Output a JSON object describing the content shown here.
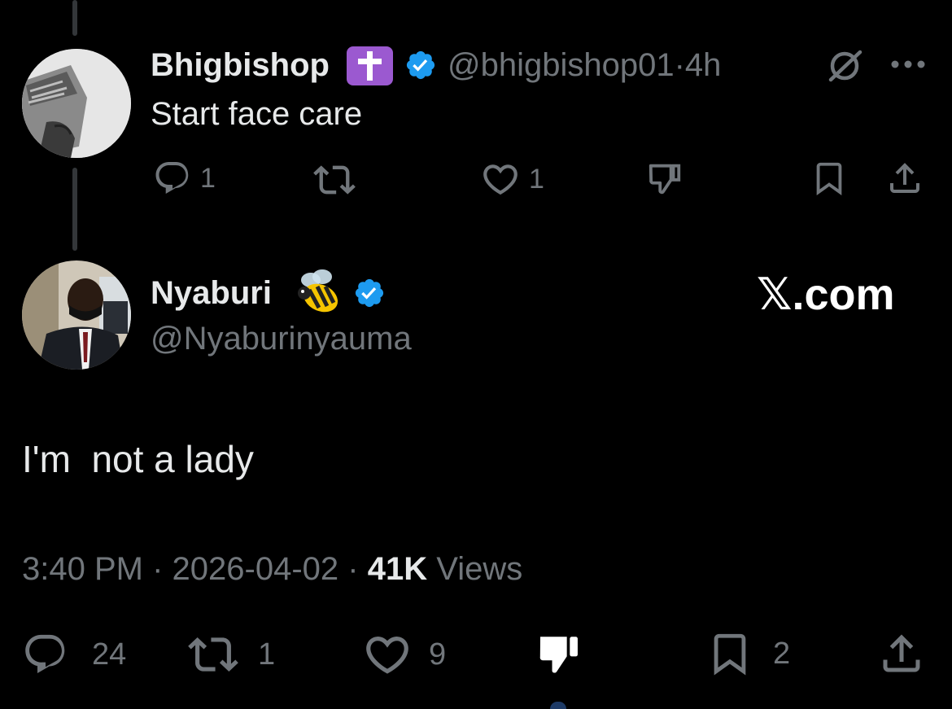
{
  "parent_post": {
    "display_name": "Bhigbishop",
    "name_emoji": "latin-cross-emoji",
    "verified": true,
    "handle": "@bhigbishop01",
    "separator": "·",
    "age": "4h",
    "text": "Start face care",
    "actions": {
      "reply_count": "1",
      "like_count": "1"
    }
  },
  "main_post": {
    "display_name": "Nyaburi",
    "name_emoji": "bee-emoji",
    "verified": true,
    "handle": "@Nyaburinyauma",
    "watermark": "𝕏.com",
    "text": "I'm  not a lady",
    "time": "3:40 PM",
    "separator": "·",
    "date": "2026-04-02",
    "views_count": "41K",
    "views_label": "Views",
    "actions": {
      "reply_count": "24",
      "repost_count": "1",
      "like_count": "9",
      "bookmark_count": "2"
    }
  },
  "colors": {
    "background": "#000000",
    "primary_text": "#e7e9ea",
    "secondary_text": "#71767b",
    "verified_blue": "#1d9bf0",
    "thread_line": "#333639",
    "cross_purple": "#9b59d0"
  },
  "icons": [
    "reply-icon",
    "repost-icon",
    "like-icon",
    "dislike-icon",
    "bookmark-icon",
    "share-icon",
    "grok-icon",
    "more-icon",
    "verified-badge-icon"
  ]
}
